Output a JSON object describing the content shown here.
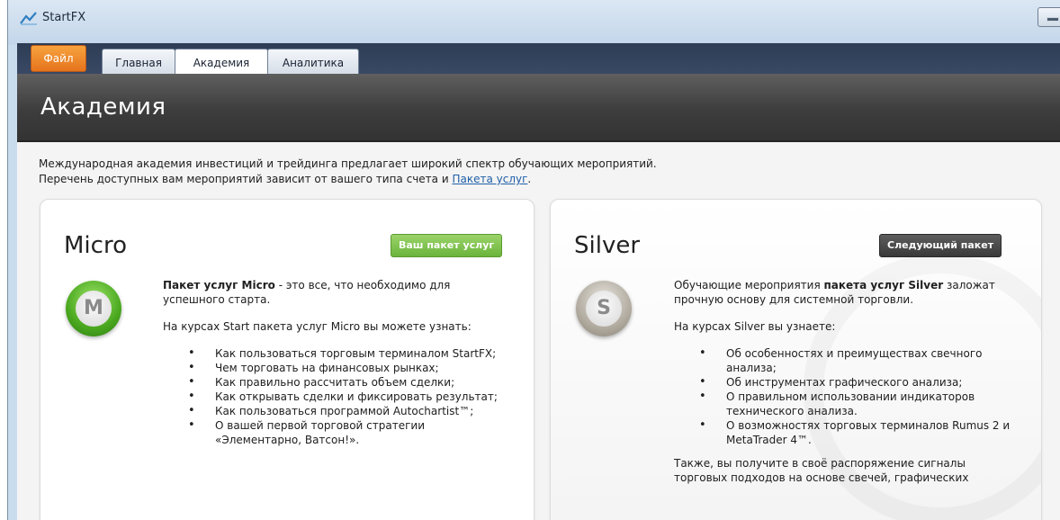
{
  "window": {
    "title": "StartFX"
  },
  "tabs": [
    {
      "label": "Файл",
      "kind": "file"
    },
    {
      "label": "Главная",
      "kind": "normal"
    },
    {
      "label": "Академия",
      "kind": "active"
    },
    {
      "label": "Аналитика",
      "kind": "normal"
    }
  ],
  "page": {
    "title": "Академия"
  },
  "intro": {
    "line1": "Международная академия инвестиций и трейдинга предлагает широкий спектр обучающих мероприятий.",
    "line2_prefix": "Перечень доступных вам мероприятий зависит от вашего типа счета и ",
    "line2_link": "Пакета услуг",
    "line2_suffix": "."
  },
  "micro": {
    "title": "Micro",
    "badge": "Ваш пакет услуг",
    "emblem_letter": "M",
    "lead_bold": "Пакет услуг Micro",
    "lead_rest": " - это все, что необходимо для успешного старта.",
    "subhead": "На курсах Start пакета услуг Micro вы можете узнать:",
    "items": [
      "Как пользоваться торговым терминалом StartFX;",
      "Чем торговать на финансовых рынках;",
      "Как правильно рассчитать объем сделки;",
      "Как открывать сделки и фиксировать результат;",
      "Как пользоваться программой Autochartist™;",
      "О вашей первой торговой стратегии «Элементарно, Ватсон!»."
    ]
  },
  "silver": {
    "title": "Silver",
    "badge": "Следующий пакет",
    "emblem_letter": "S",
    "lead_prefix": "Обучающие мероприятия ",
    "lead_bold": "пакета услуг Silver",
    "lead_rest": " заложат прочную основу для системной торговли.",
    "subhead": "На курсах Silver вы узнаете:",
    "items": [
      "Об особенностях и преимуществах свечного анализа;",
      "Об инструментах графического анализа;",
      "О правильном использовании индикаторов технического анализа.",
      "О возможностях торговых терминалов Rumus 2 и MetaTrader 4™."
    ],
    "closing": "Также, вы получите в своё распоряжение сигналы торговых подходов на основе свечей, графических"
  },
  "colors": {
    "file_tab": "#e5731d",
    "badge_current": "#6bb43c",
    "badge_next": "#3a3a3a",
    "link": "#1f5fa8"
  }
}
